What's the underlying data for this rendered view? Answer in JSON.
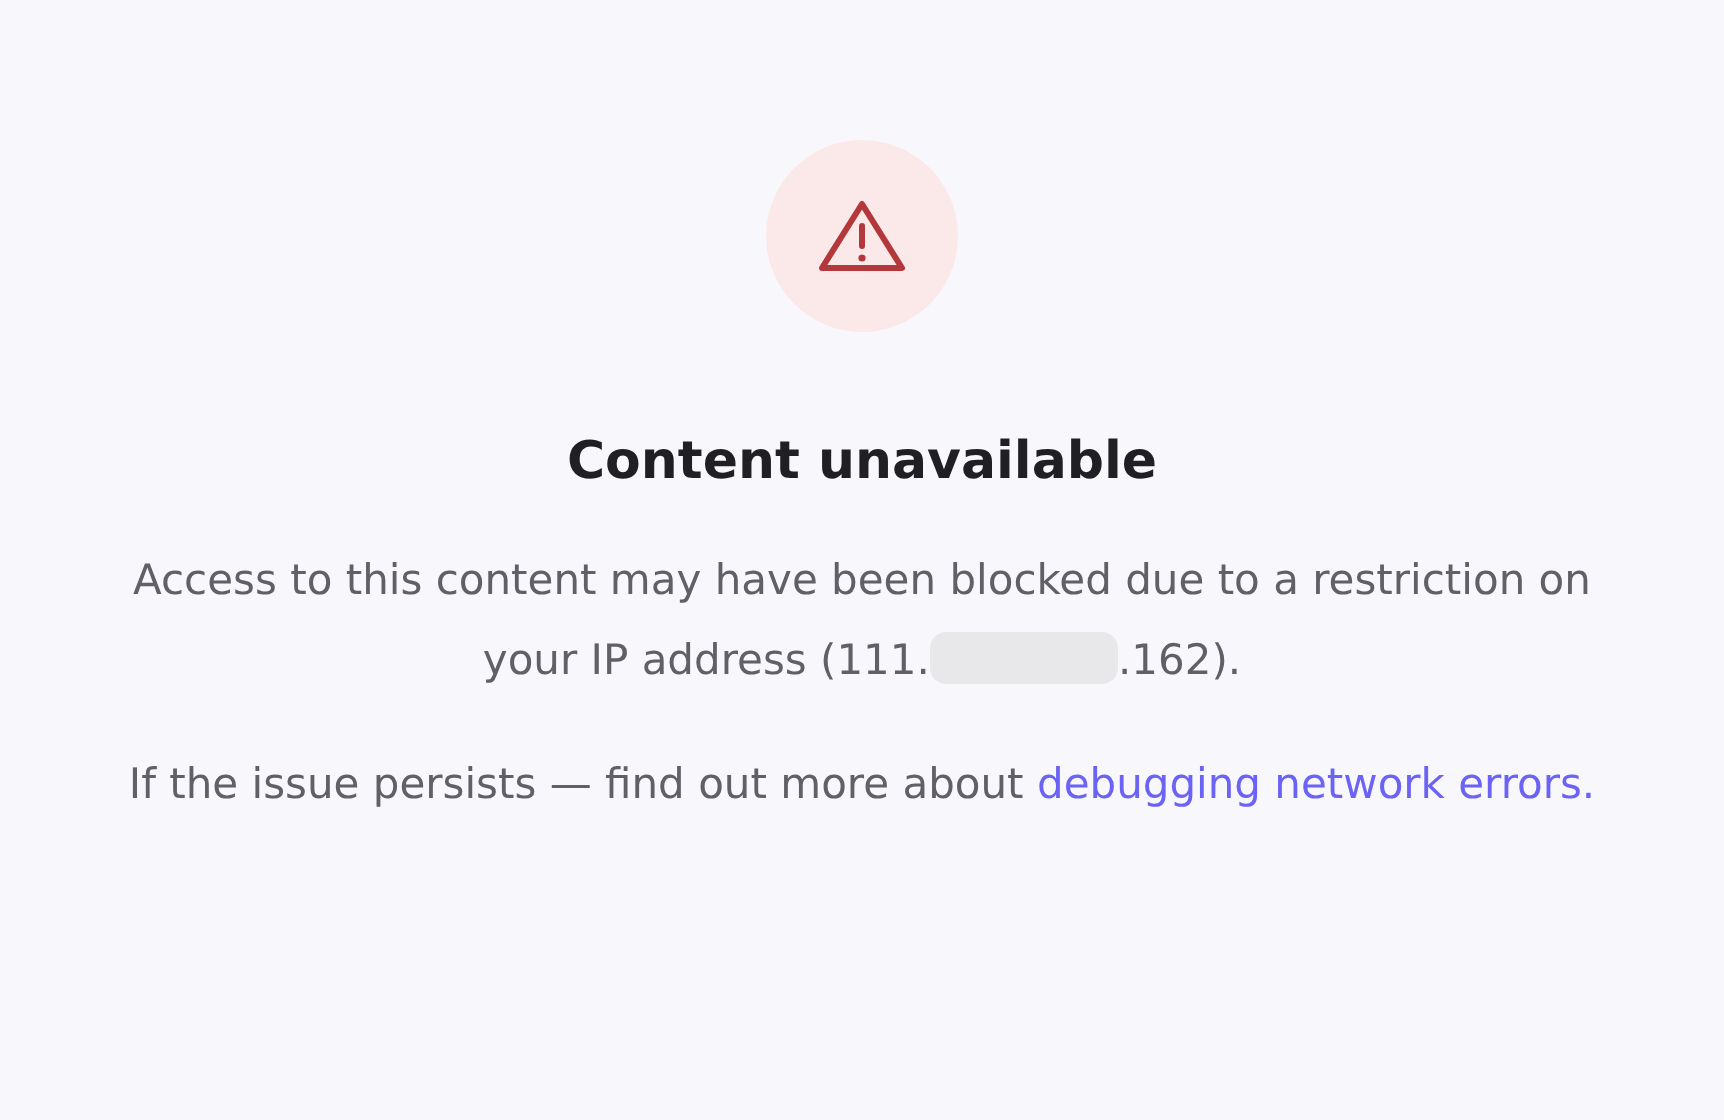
{
  "title": "Content unavailable",
  "message": {
    "before": "Access to this content may have been blocked due to a restriction on your IP address (111.",
    "after": ".162)."
  },
  "hint": {
    "text": "If the issue persists — find out more about",
    "link": "debugging network errors."
  }
}
